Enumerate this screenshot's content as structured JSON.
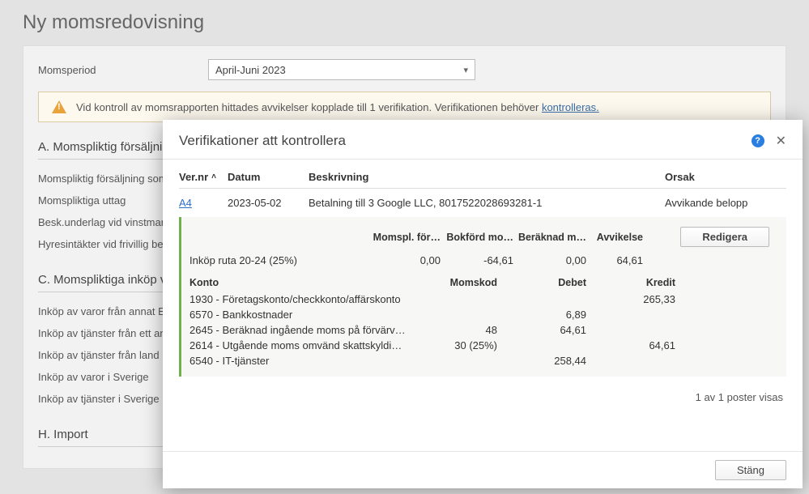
{
  "page": {
    "title": "Ny momsredovisning",
    "period_label": "Momsperiod",
    "period_value": "April-Juni 2023",
    "alert_text": "Vid kontroll av momsrapporten hittades avvikelser kopplade till 1 verifikation. Verifikationen behöver ",
    "alert_link": "kontrolleras."
  },
  "sections": {
    "a_head": "A. Momspliktig försäljning",
    "a_items": [
      "Momspliktig försäljning som ej",
      "Momspliktiga uttag",
      "Besk.underlag vid vinstmargina",
      "Hyresintäkter vid frivillig betaln"
    ],
    "c_head": "C. Momspliktiga inköp vid",
    "c_items": [
      "Inköp av varor från annat EU-la",
      "Inköp av tjänster från ett annat",
      "Inköp av tjänster från land utan",
      "Inköp av varor i Sverige",
      "Inköp av tjänster i Sverige"
    ],
    "h_head": "H. Import"
  },
  "modal": {
    "title": "Verifikationer att kontrollera",
    "cols": {
      "ver": "Ver.nr",
      "datum": "Datum",
      "beskrivning": "Beskrivning",
      "orsak": "Orsak"
    },
    "row": {
      "ver": "A4",
      "datum": "2023-05-02",
      "beskrivning": "Betalning till 3 Google LLC, 8017522028693281-1",
      "orsak": "Avvikande belopp"
    },
    "detail_cols": {
      "c1": "",
      "c2": "Momspl. för…",
      "c3": "Bokförd mo…",
      "c4": "Beräknad m…",
      "c5": "Avvikelse",
      "btn": "Redigera"
    },
    "detail_row": {
      "label": "Inköp ruta 20-24 (25%)",
      "momspl": "0,00",
      "bokford": "-64,61",
      "beraknad": "0,00",
      "avvikelse": "64,61"
    },
    "ledger_cols": {
      "konto": "Konto",
      "momskod": "Momskod",
      "debet": "Debet",
      "kredit": "Kredit"
    },
    "ledger_rows": [
      {
        "konto": "1930 - Företagskonto/checkkonto/affärskonto",
        "momskod": "",
        "debet": "",
        "kredit": "265,33"
      },
      {
        "konto": "6570 - Bankkostnader",
        "momskod": "",
        "debet": "6,89",
        "kredit": ""
      },
      {
        "konto": "2645 - Beräknad ingående moms på förvärv…",
        "momskod": "48",
        "debet": "64,61",
        "kredit": ""
      },
      {
        "konto": "2614 - Utgående moms omvänd skattskyldi…",
        "momskod": "30 (25%)",
        "debet": "",
        "kredit": "64,61"
      },
      {
        "konto": "6540 - IT-tjänster",
        "momskod": "",
        "debet": "258,44",
        "kredit": ""
      }
    ],
    "pager": "1 av 1 poster visas",
    "close_btn": "Stäng"
  }
}
